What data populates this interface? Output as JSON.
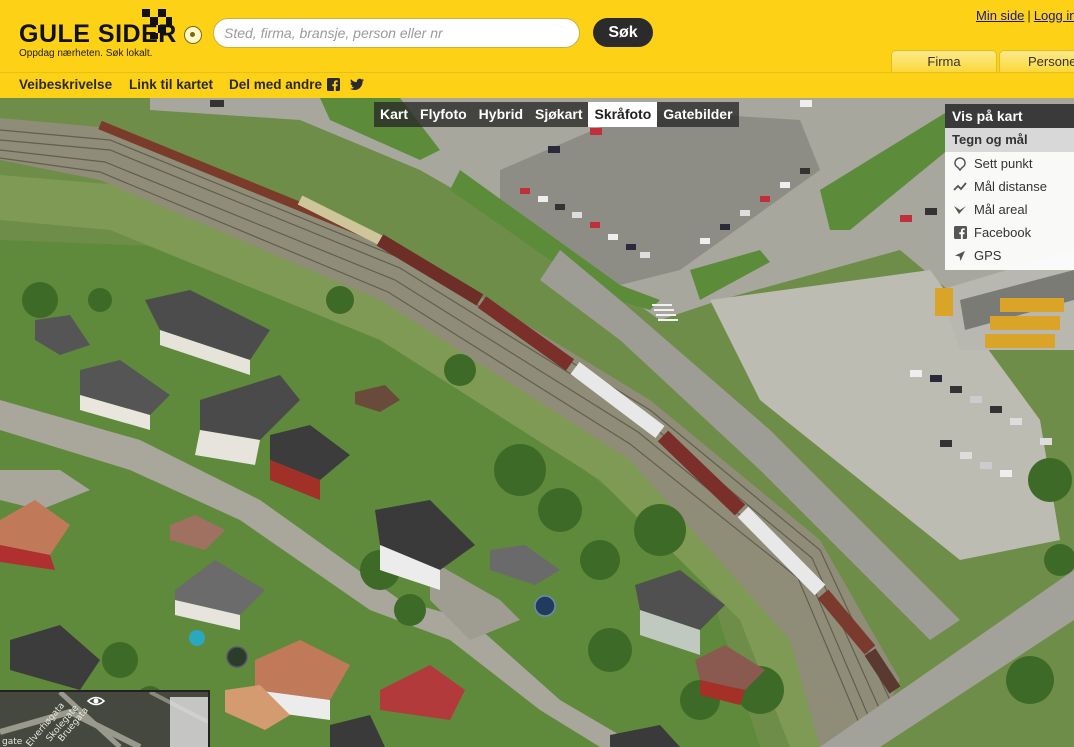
{
  "header": {
    "logo_text": "GULE SIDER",
    "tagline": "Oppdag nærheten. Søk lokalt.",
    "search": {
      "placeholder": "Sted, firma, bransje, person eller nr",
      "value": ""
    },
    "search_button": "Søk",
    "user_links": [
      "Min side",
      "Logg inn"
    ],
    "tabs": [
      "Firma",
      "Personer"
    ],
    "brand_color": "#fcd116"
  },
  "actions": {
    "directions": "Veibeskrivelse",
    "map_link": "Link til kartet",
    "share": "Del med andre"
  },
  "map_types": [
    "Kart",
    "Flyfoto",
    "Hybrid",
    "Sjøkart",
    "Skråfoto",
    "Gatebilder"
  ],
  "active_map_type": "Skråfoto",
  "panel": {
    "title": "Vis på kart",
    "subtitle": "Tegn og mål",
    "items": [
      {
        "label": "Sett punkt",
        "icon": "pin-icon"
      },
      {
        "label": "Mål distanse",
        "icon": "distance-icon"
      },
      {
        "label": "Mål areal",
        "icon": "area-icon"
      },
      {
        "label": "Facebook",
        "icon": "facebook-icon"
      },
      {
        "label": "GPS",
        "icon": "gps-icon"
      }
    ]
  },
  "minimap": {
    "streets": [
      "Bruegata",
      "Elverhøgata",
      "Skolegate",
      "gate"
    ]
  }
}
